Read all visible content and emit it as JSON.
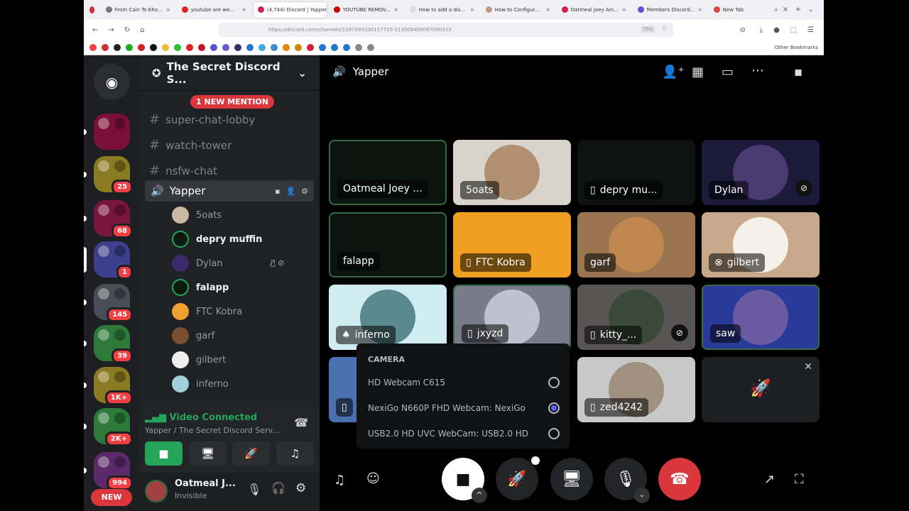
{
  "browser": {
    "tabs": [
      {
        "title": "From Cain To Kho...",
        "color": "#7a7a7a"
      },
      {
        "title": "youtube are we...",
        "color": "#d22"
      },
      {
        "title": "(4,744) Discord | Yapper",
        "color": "#c25",
        "active": true
      },
      {
        "title": "YOUTUBE REMOV...",
        "color": "#c00"
      },
      {
        "title": "How to add a dis...",
        "color": "#ddd"
      },
      {
        "title": "How to Configur...",
        "color": "#b98"
      },
      {
        "title": "Oatmeal Joey Arc...",
        "color": "#c24"
      },
      {
        "title": "Members Discord...",
        "color": "#55c"
      },
      {
        "title": "New Tab",
        "color": "#d44"
      }
    ],
    "url": "https://discord.com/channels/1587093336157720-113008400087000333",
    "zoom": "75%",
    "other_bookmarks": "Other Bookmarks"
  },
  "servers": [
    {
      "color": "#7a1035"
    },
    {
      "color": "#8a7a22",
      "badge": "25"
    },
    {
      "color": "#7a1540",
      "badge": "68"
    },
    {
      "color": "#3b3f8c",
      "badge": "1",
      "selected": true
    },
    {
      "color": "#4a4d55",
      "badge": "145"
    },
    {
      "color": "#2e7a3a",
      "badge": "39"
    },
    {
      "color": "#8a7a22",
      "badge": "1K+"
    },
    {
      "color": "#2e7a3a",
      "badge": "2K+"
    },
    {
      "color": "#5a2a6a",
      "badge": "994"
    }
  ],
  "new_label": "NEW",
  "sidebar": {
    "server_name": "The Secret Discord S...",
    "mention": "1 NEW MENTION",
    "channels": [
      "super-chat-lobby",
      "watch-tower",
      "nsfw-chat"
    ],
    "voice_channel": "Yapper",
    "members": [
      {
        "name": "5oats",
        "color": "#c9b9a0"
      },
      {
        "name": "depry muffin",
        "color": "#0d1a10",
        "ring": true,
        "bright": true
      },
      {
        "name": "Dylan",
        "color": "#3a2a6a"
      },
      {
        "name": "falapp",
        "color": "#0d1a10",
        "ring": true,
        "bright": true
      },
      {
        "name": "FTC Kobra",
        "color": "#f0a030"
      },
      {
        "name": "garf",
        "color": "#7a5030"
      },
      {
        "name": "gilbert",
        "color": "#eee"
      },
      {
        "name": "inferno",
        "color": "#a0d0d8"
      }
    ],
    "voice_status": "Video Connected",
    "voice_sub": "Yapper / The Secret Discord Serv...",
    "user": {
      "name": "Oatmeal J...",
      "status": "Invisible"
    }
  },
  "main": {
    "channel": "Yapper",
    "tiles": [
      {
        "name": "Oatmeal Joey ...",
        "bg": "#0c1410",
        "border": "#3a6a45"
      },
      {
        "name": "5oats",
        "bg": "#d8d4cc",
        "avatar": "#b09070"
      },
      {
        "name": "depry mu...",
        "bg": "#0e1210",
        "device": "phone"
      },
      {
        "name": "Dylan",
        "bg": "#1c1a3a",
        "avatar": "#4a3a70",
        "status": "video-off"
      },
      {
        "name": "falapp",
        "bg": "#0c1410",
        "border": "#3a6a45"
      },
      {
        "name": "FTC Kobra",
        "bg": "#f0a020",
        "device": "phone"
      },
      {
        "name": "garf",
        "bg": "#9a7550",
        "avatar": "#c08850"
      },
      {
        "name": "gilbert",
        "bg": "#c7a88a",
        "avatar": "#f5f0ea",
        "device": "xbox"
      },
      {
        "name": "inferno",
        "bg": "#d0ecf0",
        "avatar": "#5a8a90",
        "device": "playstation"
      },
      {
        "name": "jxyzd",
        "bg": "#7a7a8a",
        "avatar": "#c0c0d0",
        "device": "phone",
        "border": "#3a6a45"
      },
      {
        "name": "kitty_...",
        "bg": "#5a5555",
        "avatar": "#3a4a3a",
        "device": "phone",
        "status": "muted"
      },
      {
        "name": "saw",
        "bg": "#2a3a9a",
        "avatar": "#6a5aa0",
        "border": "#3a6a45"
      },
      {
        "name": "",
        "bg": "#4a70b0",
        "device": "phone"
      },
      {
        "name": "",
        "bg": "#000"
      },
      {
        "name": "zed4242",
        "bg": "#c8c8c8",
        "avatar": "#a09080",
        "device": "phone"
      },
      {
        "name": "",
        "bg": "#1e1f22",
        "activity": true
      }
    ],
    "camera_menu": {
      "title": "CAMERA",
      "options": [
        {
          "label": "HD Webcam C615",
          "selected": false
        },
        {
          "label": "NexiGo N660P FHD Webcam: NexiGo",
          "selected": true
        },
        {
          "label": "USB2.0 HD UVC WebCam: USB2.0 HD",
          "selected": false
        }
      ]
    }
  },
  "colors": {
    "accent": "#5865f2",
    "green": "#23a55a",
    "red": "#da373c"
  }
}
